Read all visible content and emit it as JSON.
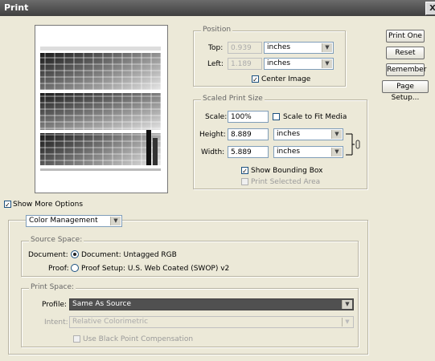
{
  "window": {
    "title": "Print",
    "close": "X"
  },
  "buttons": {
    "print_one": "Print One",
    "reset": "Reset",
    "remember": "Remember",
    "page_setup": "Page Setup..."
  },
  "position": {
    "title": "Position",
    "top_label": "Top:",
    "top_value": "0.939",
    "top_unit": "inches",
    "left_label": "Left:",
    "left_value": "1.189",
    "left_unit": "inches",
    "center_label": "Center Image"
  },
  "scaled": {
    "title": "Scaled Print Size",
    "scale_label": "Scale:",
    "scale_value": "100%",
    "scale_fit_label": "Scale to Fit Media",
    "height_label": "Height:",
    "height_value": "8.889",
    "height_unit": "inches",
    "width_label": "Width:",
    "width_value": "5.889",
    "width_unit": "inches",
    "bounding_label": "Show Bounding Box",
    "print_selected_label": "Print Selected Area"
  },
  "show_more": "Show More Options",
  "color_mgmt": {
    "dropdown": "Color Management"
  },
  "source": {
    "title": "Source Space:",
    "document_label": "Document:",
    "document_option": "Document: Untagged RGB",
    "proof_label": "Proof:",
    "proof_option": "Proof Setup: U.S. Web Coated (SWOP) v2"
  },
  "print_space": {
    "title": "Print Space:",
    "profile_label": "Profile:",
    "profile_value": "Same As Source",
    "intent_label": "Intent:",
    "intent_value": "Relative Colorimetric",
    "bpc_label": "Use Black Point Compensation"
  },
  "colors": {
    "titlebar": "#4a4a4a",
    "profile_bg": "#505050",
    "dialog_bg": "#ece9d8"
  }
}
